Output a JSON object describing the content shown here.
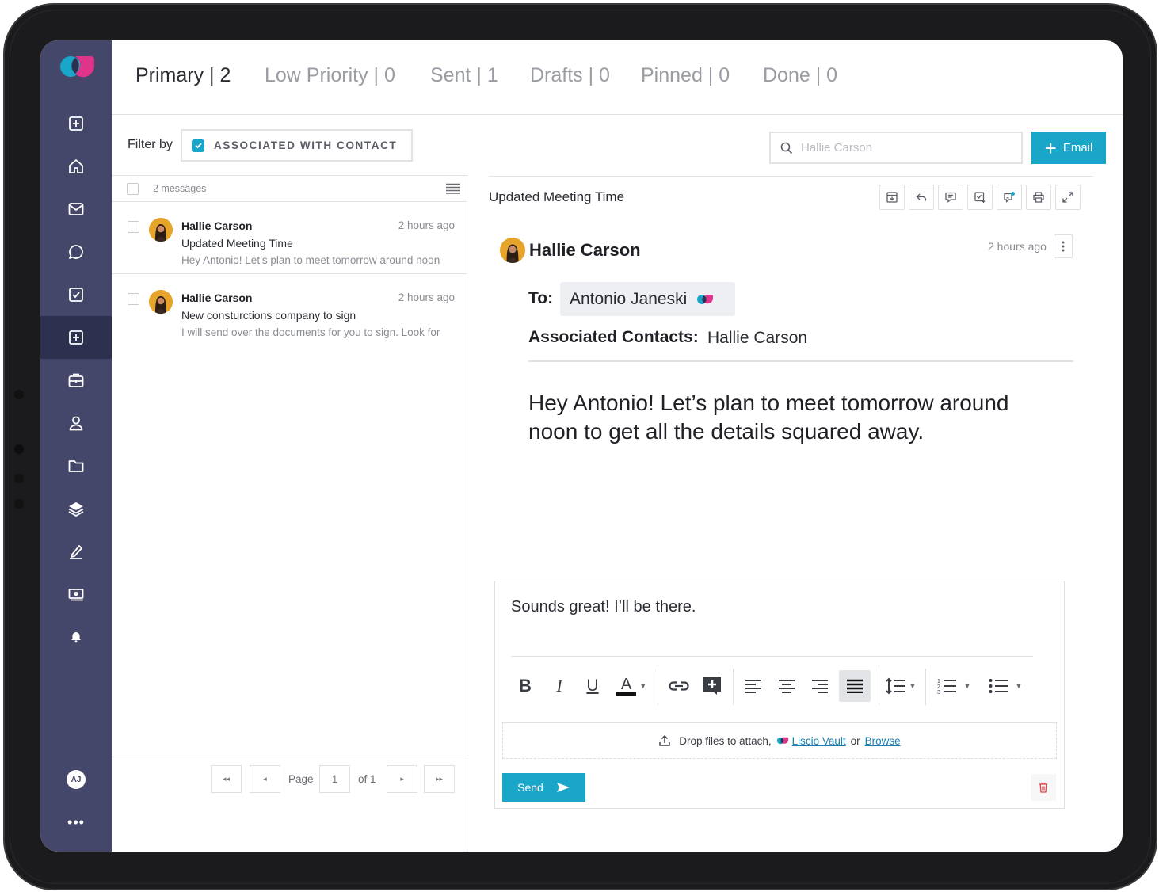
{
  "colors": {
    "sidebar": "#45476a",
    "sidebar_active": "#2e3050",
    "accent": "#1aa6c8",
    "logo_blue": "#1aa6c8",
    "logo_pink": "#e0338a"
  },
  "tabs": [
    {
      "label": "Primary | 2"
    },
    {
      "label": "Low Priority | 0"
    },
    {
      "label": "Sent | 1"
    },
    {
      "label": "Drafts | 0"
    },
    {
      "label": "Pinned | 0"
    },
    {
      "label": "Done | 0"
    }
  ],
  "sidebar": {
    "items": [
      {
        "icon": "plus-square-icon"
      },
      {
        "icon": "home-icon"
      },
      {
        "icon": "mail-icon"
      },
      {
        "icon": "chat-bubble-icon"
      },
      {
        "icon": "check-square-icon"
      },
      {
        "icon": "plus-square-icon",
        "active": true
      },
      {
        "icon": "briefcase-icon"
      },
      {
        "icon": "user-icon"
      },
      {
        "icon": "folder-icon"
      },
      {
        "icon": "layers-icon"
      },
      {
        "icon": "signature-pen-icon"
      },
      {
        "icon": "cash-icon"
      },
      {
        "icon": "bell-icon"
      }
    ],
    "user_initials": "AJ",
    "more": "•••"
  },
  "filter": {
    "label": "Filter by",
    "chip": "ASSOCIATED WITH CONTACT"
  },
  "search": {
    "placeholder": "Hallie Carson"
  },
  "email_button": {
    "label": "Email"
  },
  "list": {
    "count": "2 messages",
    "messages": [
      {
        "sender": "Hallie Carson",
        "time": "2 hours ago",
        "subject": "Updated Meeting Time",
        "preview": "Hey Antonio! Let’s plan to meet tomorrow around noon"
      },
      {
        "sender": "Hallie Carson",
        "time": "2 hours ago",
        "subject": "New consturctions company to sign",
        "preview": "I will send over the documents for you to sign. Look for"
      }
    ]
  },
  "pager": {
    "page_label": "Page",
    "page": "1",
    "of": "of 1"
  },
  "reading": {
    "subject": "Updated Meeting Time",
    "sender": "Hallie Carson",
    "time": "2 hours ago",
    "to_label": "To:",
    "to_value": "Antonio Janeski",
    "assoc_label": "Associated Contacts:",
    "assoc_value": "Hallie Carson",
    "body": "Hey Antonio! Let’s plan to meet tomorrow around noon to get all the details squared away."
  },
  "reply": {
    "text": "Sounds great! I’ll be there.",
    "drop_text": "Drop files to attach,",
    "vault_link": "Liscio Vault",
    "or": "or",
    "browse_link": "Browse",
    "send_label": "Send"
  }
}
